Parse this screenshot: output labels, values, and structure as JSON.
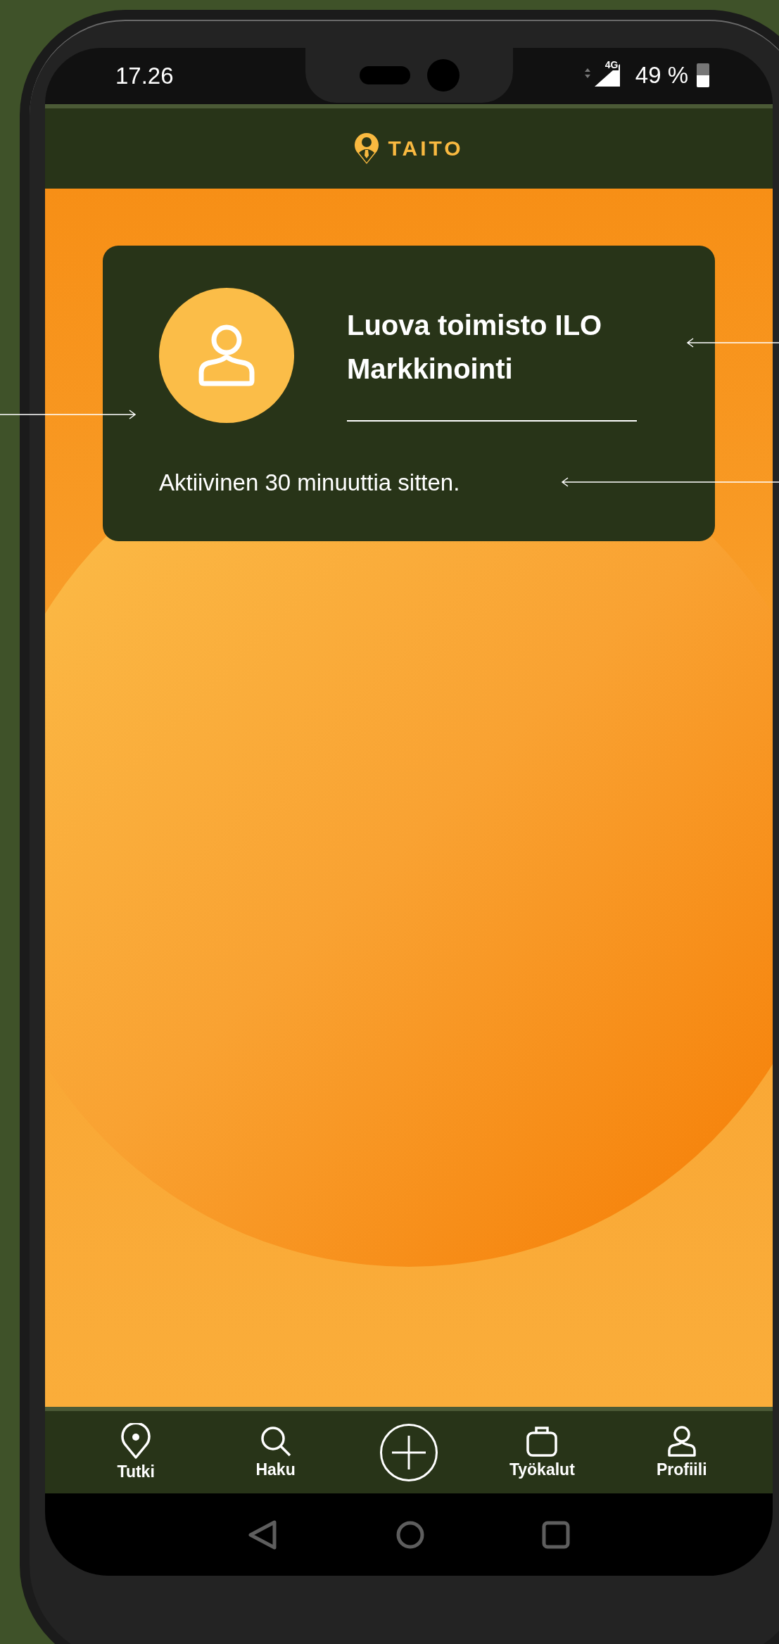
{
  "status_bar": {
    "time": "17.26",
    "network": "4G",
    "battery": "49 %",
    "battery_icon": {
      "level": 0.5
    }
  },
  "header": {
    "logo_text": "TAITO"
  },
  "profile_card": {
    "name": "Luova toimisto ILO Markkinointi",
    "activity": "Aktiivinen 30 minuuttia sitten."
  },
  "bottom_nav": [
    {
      "kind": "tab",
      "label": "Tutki"
    },
    {
      "kind": "tab",
      "label": "Haku"
    },
    {
      "kind": "add"
    },
    {
      "kind": "tab",
      "label": "Työkalut"
    },
    {
      "kind": "tab",
      "label": "Profiili"
    }
  ]
}
